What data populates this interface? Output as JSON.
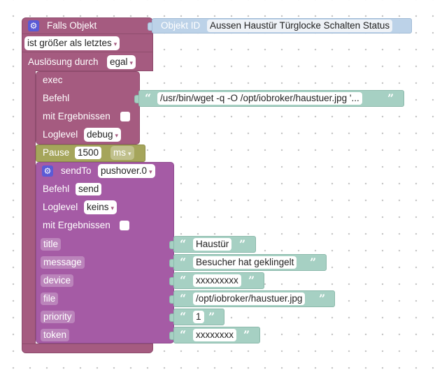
{
  "event_block": {
    "title": "Falls Objekt",
    "object_id_label": "Objekt ID",
    "object_id_value": "Aussen Haustür Türglocke Schalten Status",
    "condition_value": "ist größer als letztes",
    "trigger_label": "Auslösung durch",
    "trigger_value": "egal"
  },
  "exec_block": {
    "title": "exec",
    "command_label": "Befehl",
    "command_value": "/usr/bin/wget -q -O /opt/iobroker/haustuer.jpg '...",
    "with_results_label": "mit Ergebnissen",
    "loglevel_label": "Loglevel",
    "loglevel_value": "debug"
  },
  "pause_block": {
    "label": "Pause",
    "value": "1500",
    "unit": "ms"
  },
  "sendto_block": {
    "title": "sendTo",
    "adapter": "pushover.0",
    "command_label": "Befehl",
    "command_value": "send",
    "loglevel_label": "Loglevel",
    "loglevel_value": "keins",
    "with_results_label": "mit Ergebnissen",
    "params": [
      {
        "name": "title",
        "value": "Haustür"
      },
      {
        "name": "message",
        "value": "Besucher hat geklingelt"
      },
      {
        "name": "device",
        "value": "xxxxxxxxx"
      },
      {
        "name": "file",
        "value": "/opt/iobroker/haustuer.jpg"
      },
      {
        "name": "priority",
        "value": "1"
      },
      {
        "name": "token",
        "value": "xxxxxxxx"
      }
    ]
  },
  "icons": {
    "gear": "⚙",
    "dropdown_arrow": "▾",
    "open_quote": "“",
    "close_quote": "”"
  }
}
